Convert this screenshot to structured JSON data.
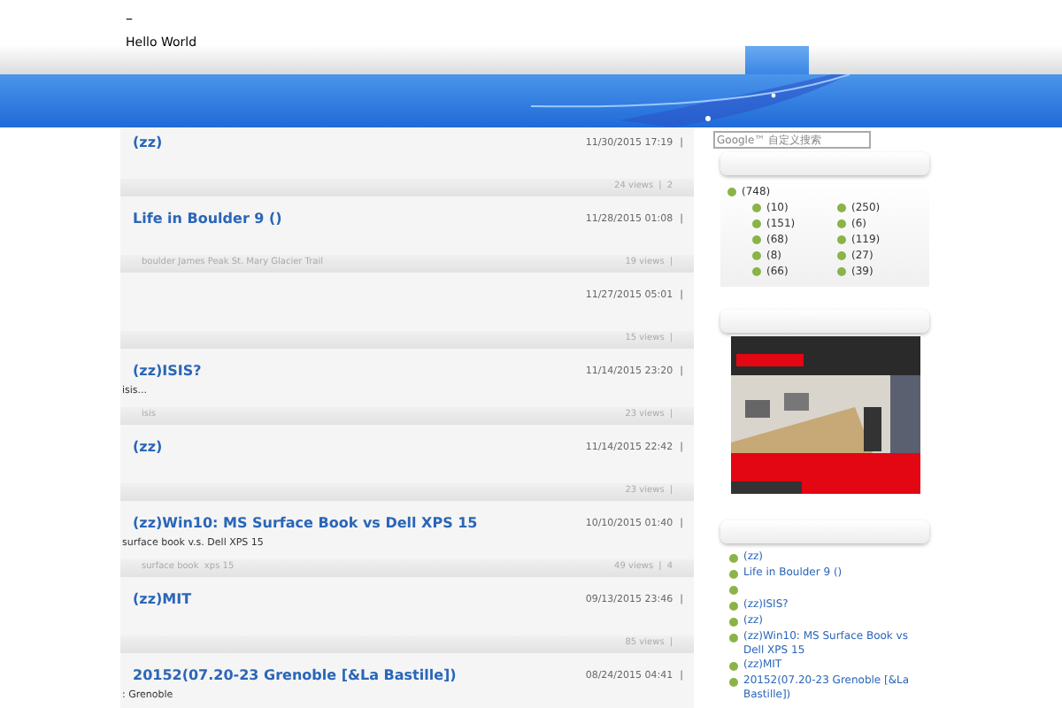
{
  "header": {
    "mark": "–",
    "title": "Hello World"
  },
  "posts": [
    {
      "title": "(zz)",
      "date": "11/30/2015 17:19",
      "separator": "|",
      "views": "24 views",
      "comments": "2"
    },
    {
      "title": "Life in Boulder 9 ()",
      "date": "11/28/2015 01:08",
      "separator": "|",
      "tags": "boulder James Peak St. Mary Glacier Trail",
      "views": "19 views"
    },
    {
      "date": "11/27/2015 05:01",
      "separator": "|",
      "views": "15 views"
    },
    {
      "title": "(zz)ISIS?",
      "date": "11/14/2015 23:20",
      "separator": "|",
      "excerpt": "isis...",
      "tags": "isis",
      "views": "23 views"
    },
    {
      "title": "(zz)",
      "date": "11/14/2015 22:42",
      "separator": "|",
      "views": "23 views"
    },
    {
      "title": "(zz)Win10: MS Surface Book vs Dell XPS 15",
      "date": "10/10/2015 01:40",
      "separator": "|",
      "excerpt": "surface book v.s. Dell XPS 15",
      "tags": "surface book  xps 15",
      "views": "49 views",
      "comments": "4"
    },
    {
      "title": "(zz)MIT",
      "date": "09/13/2015 23:46",
      "separator": "|",
      "views": "85 views"
    },
    {
      "title": "20152(07.20-23 Grenoble [&La Bastille])",
      "date": "08/24/2015 04:41",
      "separator": "|",
      "excerpt": ": Grenoble"
    }
  ],
  "sidebar": {
    "search": {
      "placeholder": "Google™ 自定义搜索"
    },
    "categories": {
      "total": "(748)",
      "items": [
        "(10)",
        "(250)",
        "(151)",
        "(6)",
        "(68)",
        "(119)",
        "(8)",
        "(27)",
        "(66)",
        "(39)"
      ]
    },
    "recent_posts": [
      {
        "kind": "link",
        "title": "(zz)"
      },
      {
        "kind": "link",
        "title": "Life in Boulder 9 ()"
      },
      {
        "kind": "blank"
      },
      {
        "kind": "link",
        "title": "(zz)ISIS?"
      },
      {
        "kind": "link",
        "title": "(zz)"
      },
      {
        "kind": "link",
        "title": "(zz)Win10: MS Surface Book vs Dell XPS 15"
      },
      {
        "kind": "link",
        "title": "(zz)MIT"
      },
      {
        "kind": "link",
        "title": "20152(07.20-23 Grenoble [&La Bastille])"
      }
    ]
  }
}
